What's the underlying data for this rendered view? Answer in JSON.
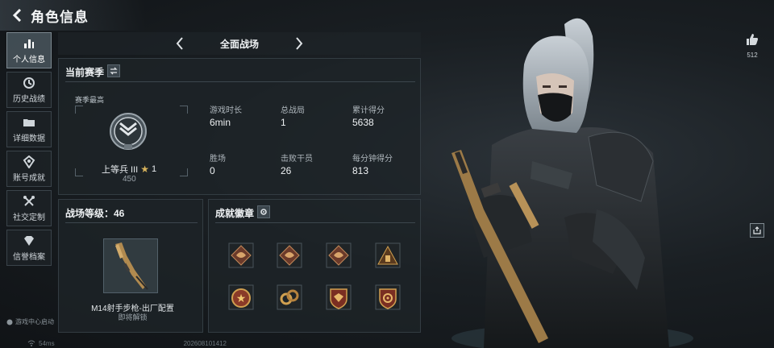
{
  "header": {
    "title": "角色信息"
  },
  "sidebar": {
    "items": [
      {
        "label": "个人信息",
        "icon": "bar-chart-icon",
        "active": true
      },
      {
        "label": "历史战绩",
        "icon": "history-icon",
        "active": false
      },
      {
        "label": "详细数据",
        "icon": "folder-icon",
        "active": false
      },
      {
        "label": "账号成就",
        "icon": "achievement-icon",
        "active": false
      },
      {
        "label": "社交定制",
        "icon": "tools-icon",
        "active": false
      },
      {
        "label": "信誉档案",
        "icon": "diamond-icon",
        "active": false
      }
    ],
    "footer": "游戏中心启动"
  },
  "mode_nav": {
    "current": "全面战场"
  },
  "season": {
    "title": "当前赛季",
    "subtitle": "赛季最高",
    "rank_name": "上等兵 III",
    "stars": "1",
    "rank_score": "450",
    "stats": [
      {
        "label": "游戏时长",
        "value": "6min"
      },
      {
        "label": "总战局",
        "value": "1"
      },
      {
        "label": "累计得分",
        "value": "5638"
      },
      {
        "label": "胜场",
        "value": "0"
      },
      {
        "label": "击败干员",
        "value": "26"
      },
      {
        "label": "每分钟得分",
        "value": "813"
      }
    ]
  },
  "battlefield": {
    "title": "战场等级：46",
    "weapon_name": "M14射手步枪-出厂配置",
    "weapon_status": "即将解锁"
  },
  "achievements": {
    "title": "成就徽章",
    "badges": [
      "dragon-badge-icon",
      "dragon-badge-icon",
      "dragon-badge-icon",
      "pyramid-badge-icon",
      "star-medal-icon",
      "chain-badge-icon",
      "shield-eagle-badge-icon",
      "shield-target-badge-icon"
    ]
  },
  "social": {
    "likes": "512"
  },
  "status_bar": {
    "ping": "54ms",
    "id_text": "202608101412"
  },
  "colors": {
    "accent_gold": "#c9a45a",
    "panel_bg": "#1e2428",
    "active_tab": "#46525a"
  }
}
